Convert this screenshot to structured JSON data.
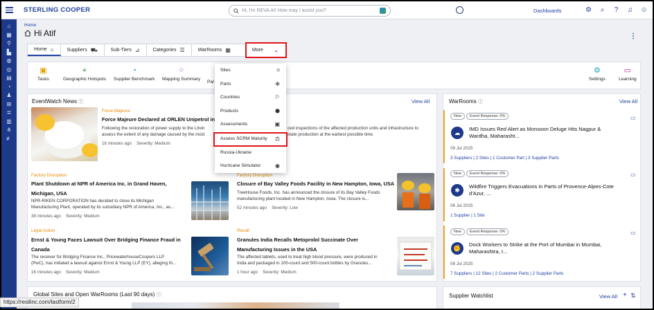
{
  "app": {
    "brand": "STERLING COOPER",
    "dashboards_label": "Dashboards"
  },
  "search": {
    "placeholder": "Hi, I'm REVA AI! How may I assist you?"
  },
  "page": {
    "breadcrumb": "Home",
    "greeting": "Hi Atif"
  },
  "tabs": [
    {
      "label": "Home",
      "icon": "home-icon"
    },
    {
      "label": "Suppliers",
      "icon": "suppliers-icon"
    },
    {
      "label": "Sub-Tiers",
      "icon": "sub-tiers-icon"
    },
    {
      "label": "Categories",
      "icon": "list-icon"
    },
    {
      "label": "WarRooms",
      "icon": "calendar-icon"
    },
    {
      "label": "More",
      "icon": "chevron-down-icon"
    }
  ],
  "quick_actions": [
    {
      "label": "Tasks",
      "icon": "clipboard-icon"
    },
    {
      "label": "Geographic Hotspots",
      "icon": "map-pin-icon"
    },
    {
      "label": "Supplier Benchmark",
      "icon": "gauge-icon"
    },
    {
      "label": "Mapping Summary",
      "icon": "nodes-icon"
    },
    {
      "label": "Par",
      "icon": ""
    },
    {
      "label": "Settings",
      "icon": "gear-icon"
    },
    {
      "label": "Learning",
      "icon": "book-icon"
    }
  ],
  "more_menu": [
    {
      "label": "Sites",
      "icon": "location-pin-icon"
    },
    {
      "label": "Parts",
      "icon": "gear-parts-icon"
    },
    {
      "label": "Countries",
      "icon": "flag-icon"
    },
    {
      "label": "Products",
      "icon": "box-icon"
    },
    {
      "label": "Assessments",
      "icon": "clipboard-check-icon"
    },
    {
      "label": "Assess SCRM Maturity",
      "icon": "scale-icon"
    },
    {
      "label": "Russia-Ukraine",
      "icon": ""
    },
    {
      "label": "Hurricane Simulator",
      "icon": "hurricane-icon"
    }
  ],
  "eventwatch": {
    "title": "EventWatch News",
    "view_all": "View All",
    "items": [
      {
        "category": "Force Majeure",
        "title": "Force Majeure Declared at ORLEN Unipetrol in",
        "text1": "Following the restoration of power supply to the Litvin",
        "text2": "assess the extent of any damage caused by the incid",
        "text1_tail": "ced inspections of the affected production units and infrastructure to",
        "text2_tail": "state production at the earliest possible time.",
        "time": "16 minutes ago",
        "severity": "Severity: Medium"
      },
      {
        "category": "Factory Disruption",
        "title1": "Plant Shutdown at NPR of America Inc. in Grand Haven,",
        "title2": "Michigan, USA",
        "text1": "NPR-RIKEN CORPORATION has decided to close its Michigan",
        "text2": "Manufacturing Plant, operated by its subsidiary NPR of America, Inc., as...",
        "time": "38 minutes ago",
        "severity": "Severity: Medium"
      },
      {
        "category": "Factory Disruption",
        "title": "Closure of Bay Valley Foods Facility in New Hampton, Iowa, USA",
        "text1": "TreeHouse Foods, Inc. has announced the closure of its Bay Valley Foods",
        "text2": "manufacturing plant located in New Hampton, Iowa. The closure is...",
        "time": "52 minutes ago",
        "severity": "Severity: Low"
      },
      {
        "category": "Legal Action",
        "title1": "Ernst & Young Faces Lawsuit Over Bridging Finance Fraud in",
        "title2": "Canada",
        "text1": "The receiver for Bridging Finance Inc., PricewaterhouseCoopers LLP",
        "text2": "(PwC), has initiated a lawsuit against Ernst & Young LLP (EY), alleging th...",
        "time": "16 minutes ago",
        "severity": "Severity: Medium"
      },
      {
        "category": "Recall",
        "title1": "Granules India Recalls Metoprolol Succinate Over",
        "title2": "Manufacturing Issues in the USA",
        "text1": "The affected tablets, used to treat high blood pressure, were produced in",
        "text2": "India and packaged in 100-count and 500-count bottles by Granules...",
        "time": "1 hour ago",
        "severity": "Severity: Medium"
      }
    ]
  },
  "warrooms": {
    "title": "WarRooms",
    "view_all": "View All",
    "items": [
      {
        "badge_new": "New",
        "badge_event": "Event Response: 0%",
        "title1": "IMD Issues Red Alert as Monsoon Deluge Hits Nagpur &",
        "title2": "Wardha, Maharasht...",
        "date": "09 Jul 2025",
        "links": "3 Suppliers | 2 Sites | 1 Customer Part | 3 Supplier Parts"
      },
      {
        "badge_new": "New",
        "badge_event": "Event Response: 0%",
        "title1": "Wildfire Triggers Evacuations in Parts of Provence-Alpes-Cote",
        "title2": "d'Azur, ...",
        "date": "08 Jul 2025",
        "links": "1 Supplier | 1 Site"
      },
      {
        "badge_new": "New",
        "badge_event": "Event Response: 0%",
        "title1": "Dock Workers to Strike at the Port of Mumbai in Mumbai,",
        "title2": "Maharashtra, I...",
        "date": "08 Jul 2025",
        "links": "7 Suppliers | 12 Sites | 2 Customer Parts | 2 Supplier Parts"
      }
    ]
  },
  "global_sites": {
    "title": "Global Sites and Open WarRooms (Last 90 days)"
  },
  "watchlist": {
    "title": "Supplier Watchlist",
    "view_all": "View All"
  },
  "status_bar": {
    "url": "https://resilinc.com/lastform/2"
  }
}
